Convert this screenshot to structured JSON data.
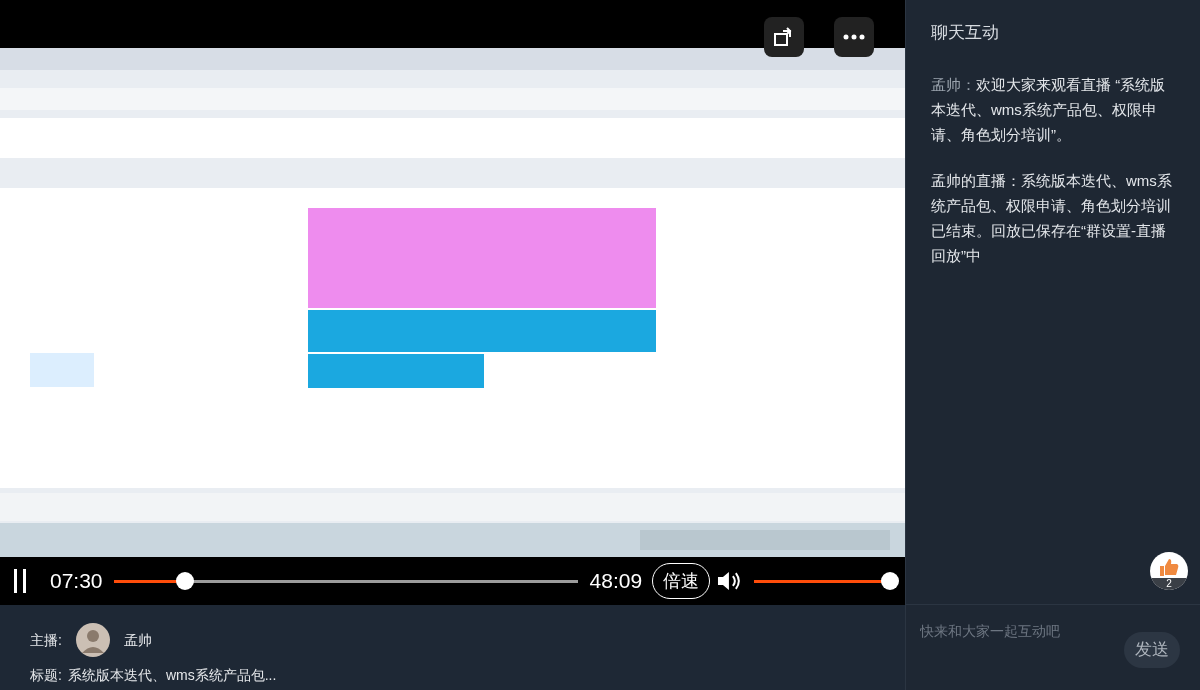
{
  "player": {
    "playing": true,
    "current_time": "07:30",
    "duration": "48:09",
    "progress": {
      "level": 0.153
    },
    "speed_button": "倍速",
    "volume": {
      "level": 1
    }
  },
  "stream_info": {
    "host_label": "主播:",
    "host_name": "孟帅",
    "title_label": "标题:",
    "title": "系统版本迭代、wms系统产品包..."
  },
  "chat": {
    "title": "聊天互动",
    "messages": [
      {
        "kind": "user",
        "author": "孟帅：",
        "text": "欢迎大家来观看直播 “系统版本迭代、wms系统产品包、权限申请、角色划分培训”。"
      },
      {
        "kind": "system",
        "text": "孟帅的直播：系统版本迭代、wms系统产品包、权限申请、角色划分培训已结束。回放已保存在“群设置-直播回放”中"
      }
    ],
    "like_count": "2",
    "input": {
      "placeholder": "快来和大家一起互动吧"
    },
    "send_button": "发送"
  }
}
